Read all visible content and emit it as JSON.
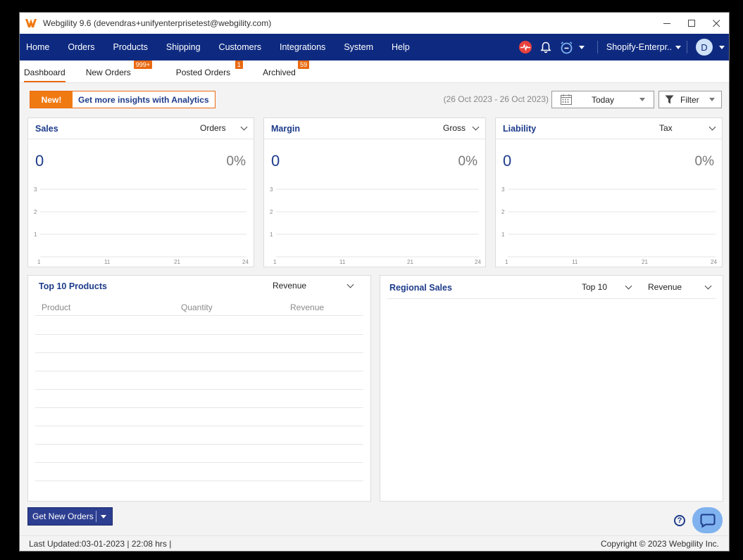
{
  "window": {
    "title": "Webgility 9.6 (devendras+unifyenterprisetest@webgility.com)"
  },
  "nav": {
    "items": [
      "Home",
      "Orders",
      "Products",
      "Shipping",
      "Customers",
      "Integrations",
      "System",
      "Help"
    ],
    "store": "Shopify-Enterpr..",
    "avatar_initial": "D"
  },
  "tabs": [
    {
      "label": "Dashboard",
      "badge": ""
    },
    {
      "label": "New Orders",
      "badge": "999+"
    },
    {
      "label": "Posted Orders",
      "badge": "1"
    },
    {
      "label": "Archived",
      "badge": "59"
    }
  ],
  "toolbar": {
    "promo_new": "New!",
    "promo_text": "Get more insights with Analytics",
    "date_range": "(26 Oct 2023 - 26 Oct 2023)",
    "date_select": "Today",
    "filter_label": "Filter"
  },
  "cards": {
    "sales": {
      "title": "Sales",
      "select": "Orders",
      "value": "0",
      "percent": "0%"
    },
    "margin": {
      "title": "Margin",
      "select": "Gross",
      "value": "0",
      "percent": "0%"
    },
    "liability": {
      "title": "Liability",
      "select": "Tax",
      "value": "0",
      "percent": "0%"
    }
  },
  "mini_chart": {
    "y_ticks": [
      "3",
      "2",
      "1"
    ],
    "x_ticks": [
      "1",
      "11",
      "21",
      "24"
    ]
  },
  "top_products": {
    "title": "Top 10 Products",
    "select": "Revenue",
    "columns": [
      "Product",
      "Quantity",
      "Revenue"
    ]
  },
  "regional_sales": {
    "title": "Regional Sales",
    "select_count": "Top 10",
    "select_metric": "Revenue"
  },
  "actions": {
    "get_new_orders": "Get New Orders"
  },
  "status": {
    "last_updated": "Last Updated:03-01-2023 | 22:08 hrs |",
    "copyright": "Copyright © 2023 Webgility Inc."
  },
  "colors": {
    "nav_bg": "#0e2a80",
    "accent": "#e96a12",
    "title_blue": "#1d3b8a"
  }
}
